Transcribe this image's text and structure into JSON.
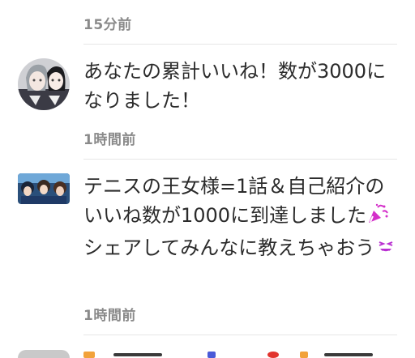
{
  "notifications": [
    {
      "time": "15分前"
    },
    {
      "message": "あなたの累計いいね！数が3000になりました！",
      "time": "1時間前",
      "avatar": "avatar-two-characters-icon"
    },
    {
      "message_parts": [
        "テニスの王女様=1話＆自己紹介のいいね数が1000に到達しました",
        "シェアしてみんなに教えちゃおう"
      ],
      "time": "1時間前",
      "avatar": "avatar-tennis-group-icon"
    }
  ],
  "colors": {
    "time_text": "#8a8a8a",
    "divider": "#e6e6e6",
    "party_emoji": "#d42fc9",
    "smile_emoji": "#b92fd1"
  }
}
